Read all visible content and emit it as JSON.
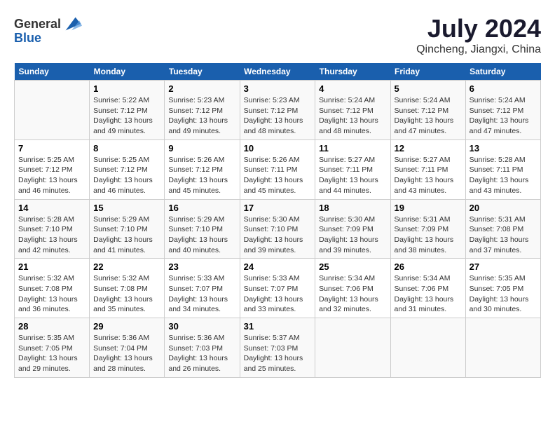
{
  "header": {
    "logo_line1": "General",
    "logo_line2": "Blue",
    "main_title": "July 2024",
    "subtitle": "Qincheng, Jiangxi, China"
  },
  "weekdays": [
    "Sunday",
    "Monday",
    "Tuesday",
    "Wednesday",
    "Thursday",
    "Friday",
    "Saturday"
  ],
  "weeks": [
    [
      {
        "day": "",
        "info": ""
      },
      {
        "day": "1",
        "info": "Sunrise: 5:22 AM\nSunset: 7:12 PM\nDaylight: 13 hours and 49 minutes."
      },
      {
        "day": "2",
        "info": "Sunrise: 5:23 AM\nSunset: 7:12 PM\nDaylight: 13 hours and 49 minutes."
      },
      {
        "day": "3",
        "info": "Sunrise: 5:23 AM\nSunset: 7:12 PM\nDaylight: 13 hours and 48 minutes."
      },
      {
        "day": "4",
        "info": "Sunrise: 5:24 AM\nSunset: 7:12 PM\nDaylight: 13 hours and 48 minutes."
      },
      {
        "day": "5",
        "info": "Sunrise: 5:24 AM\nSunset: 7:12 PM\nDaylight: 13 hours and 47 minutes."
      },
      {
        "day": "6",
        "info": "Sunrise: 5:24 AM\nSunset: 7:12 PM\nDaylight: 13 hours and 47 minutes."
      }
    ],
    [
      {
        "day": "7",
        "info": "Sunrise: 5:25 AM\nSunset: 7:12 PM\nDaylight: 13 hours and 46 minutes."
      },
      {
        "day": "8",
        "info": "Sunrise: 5:25 AM\nSunset: 7:12 PM\nDaylight: 13 hours and 46 minutes."
      },
      {
        "day": "9",
        "info": "Sunrise: 5:26 AM\nSunset: 7:12 PM\nDaylight: 13 hours and 45 minutes."
      },
      {
        "day": "10",
        "info": "Sunrise: 5:26 AM\nSunset: 7:11 PM\nDaylight: 13 hours and 45 minutes."
      },
      {
        "day": "11",
        "info": "Sunrise: 5:27 AM\nSunset: 7:11 PM\nDaylight: 13 hours and 44 minutes."
      },
      {
        "day": "12",
        "info": "Sunrise: 5:27 AM\nSunset: 7:11 PM\nDaylight: 13 hours and 43 minutes."
      },
      {
        "day": "13",
        "info": "Sunrise: 5:28 AM\nSunset: 7:11 PM\nDaylight: 13 hours and 43 minutes."
      }
    ],
    [
      {
        "day": "14",
        "info": "Sunrise: 5:28 AM\nSunset: 7:10 PM\nDaylight: 13 hours and 42 minutes."
      },
      {
        "day": "15",
        "info": "Sunrise: 5:29 AM\nSunset: 7:10 PM\nDaylight: 13 hours and 41 minutes."
      },
      {
        "day": "16",
        "info": "Sunrise: 5:29 AM\nSunset: 7:10 PM\nDaylight: 13 hours and 40 minutes."
      },
      {
        "day": "17",
        "info": "Sunrise: 5:30 AM\nSunset: 7:10 PM\nDaylight: 13 hours and 39 minutes."
      },
      {
        "day": "18",
        "info": "Sunrise: 5:30 AM\nSunset: 7:09 PM\nDaylight: 13 hours and 39 minutes."
      },
      {
        "day": "19",
        "info": "Sunrise: 5:31 AM\nSunset: 7:09 PM\nDaylight: 13 hours and 38 minutes."
      },
      {
        "day": "20",
        "info": "Sunrise: 5:31 AM\nSunset: 7:08 PM\nDaylight: 13 hours and 37 minutes."
      }
    ],
    [
      {
        "day": "21",
        "info": "Sunrise: 5:32 AM\nSunset: 7:08 PM\nDaylight: 13 hours and 36 minutes."
      },
      {
        "day": "22",
        "info": "Sunrise: 5:32 AM\nSunset: 7:08 PM\nDaylight: 13 hours and 35 minutes."
      },
      {
        "day": "23",
        "info": "Sunrise: 5:33 AM\nSunset: 7:07 PM\nDaylight: 13 hours and 34 minutes."
      },
      {
        "day": "24",
        "info": "Sunrise: 5:33 AM\nSunset: 7:07 PM\nDaylight: 13 hours and 33 minutes."
      },
      {
        "day": "25",
        "info": "Sunrise: 5:34 AM\nSunset: 7:06 PM\nDaylight: 13 hours and 32 minutes."
      },
      {
        "day": "26",
        "info": "Sunrise: 5:34 AM\nSunset: 7:06 PM\nDaylight: 13 hours and 31 minutes."
      },
      {
        "day": "27",
        "info": "Sunrise: 5:35 AM\nSunset: 7:05 PM\nDaylight: 13 hours and 30 minutes."
      }
    ],
    [
      {
        "day": "28",
        "info": "Sunrise: 5:35 AM\nSunset: 7:05 PM\nDaylight: 13 hours and 29 minutes."
      },
      {
        "day": "29",
        "info": "Sunrise: 5:36 AM\nSunset: 7:04 PM\nDaylight: 13 hours and 28 minutes."
      },
      {
        "day": "30",
        "info": "Sunrise: 5:36 AM\nSunset: 7:03 PM\nDaylight: 13 hours and 26 minutes."
      },
      {
        "day": "31",
        "info": "Sunrise: 5:37 AM\nSunset: 7:03 PM\nDaylight: 13 hours and 25 minutes."
      },
      {
        "day": "",
        "info": ""
      },
      {
        "day": "",
        "info": ""
      },
      {
        "day": "",
        "info": ""
      }
    ]
  ]
}
